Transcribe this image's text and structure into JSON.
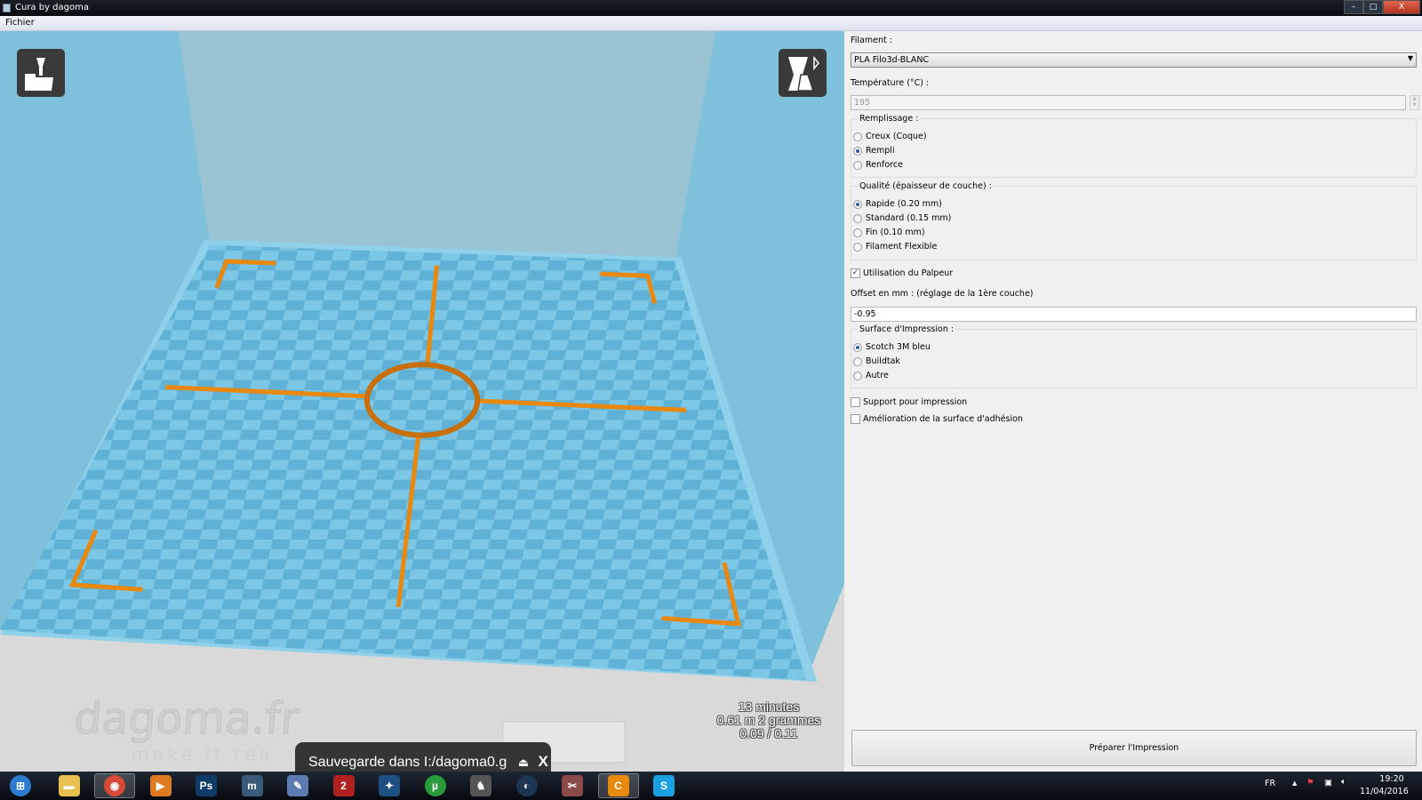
{
  "window": {
    "title": "Cura by dagoma",
    "minimize": "–",
    "maximize": "□",
    "close": "X"
  },
  "menu": {
    "file": "Fichier"
  },
  "viewport": {
    "load_button": "load-model",
    "view_button": "view-mode",
    "watermark": {
      "brand": "dagoma.fr",
      "tagline": "make it real"
    },
    "stats": {
      "time": "13 minutes",
      "material": "0.61 m 2 grammes",
      "cost": "0.09 / 0.11"
    },
    "toast": {
      "text": "Sauvegarde dans I:/dagoma0.g",
      "eject": "⏏",
      "close": "X"
    },
    "colors": {
      "bed": "#7fc0da",
      "print": "#e8880f"
    }
  },
  "panel": {
    "filament_label": "Filament :",
    "filament_value": "PLA Filo3d-BLANC",
    "temperature_label": "Température (°C) :",
    "temperature_value": "195",
    "infill": {
      "title": "Remplissage :",
      "options": [
        "Creux (Coque)",
        "Rempli",
        "Renforce"
      ],
      "selected": 1
    },
    "quality": {
      "title": "Qualité (épaisseur de couche) :",
      "options": [
        "Rapide (0.20 mm)",
        "Standard (0.15 mm)",
        "Fin (0.10 mm)",
        "Filament Flexible"
      ],
      "selected": 0
    },
    "probe": {
      "label": "Utilisation du Palpeur",
      "checked": true,
      "mark": "✓"
    },
    "offset_label": "Offset en mm : (réglage de la 1ère couche)",
    "offset_value": "-0.95",
    "surface": {
      "title": "Surface d'Impression :",
      "options": [
        "Scotch 3M bleu",
        "Buildtak",
        "Autre"
      ],
      "selected": 0
    },
    "support": {
      "label": "Support pour impression",
      "checked": false
    },
    "adhesion": {
      "label": "Amélioration de la surface d'adhésion",
      "checked": false
    },
    "prepare_button": "Préparer l'Impression"
  },
  "taskbar": {
    "apps": [
      {
        "name": "start",
        "glyph": "⊞",
        "color": "#2c7bd1"
      },
      {
        "name": "explorer",
        "glyph": "▬",
        "color": "#e8c050"
      },
      {
        "name": "chrome",
        "glyph": "◉",
        "color": "#d94a38"
      },
      {
        "name": "media-player",
        "glyph": "▶",
        "color": "#e07a20"
      },
      {
        "name": "photoshop",
        "glyph": "Ps",
        "color": "#0d3a66"
      },
      {
        "name": "app-m",
        "glyph": "m",
        "color": "#3a5a7a"
      },
      {
        "name": "app-feather",
        "glyph": "✎",
        "color": "#5a7ab0"
      },
      {
        "name": "guild-wars-2",
        "glyph": "2",
        "color": "#b02020"
      },
      {
        "name": "battlenet",
        "glyph": "✦",
        "color": "#1d4f80"
      },
      {
        "name": "utorrent",
        "glyph": "µ",
        "color": "#2a9a3a"
      },
      {
        "name": "game",
        "glyph": "♞",
        "color": "#555555"
      },
      {
        "name": "steam",
        "glyph": "◐",
        "color": "#1b3552"
      },
      {
        "name": "snipping-tool",
        "glyph": "✂",
        "color": "#8a4a4a"
      },
      {
        "name": "cura",
        "glyph": "C",
        "color": "#e88a10"
      },
      {
        "name": "skype",
        "glyph": "S",
        "color": "#1aa0e0"
      }
    ],
    "tray": {
      "language": "FR",
      "show_hidden": "▲",
      "time": "19:20",
      "date": "11/04/2016"
    }
  }
}
